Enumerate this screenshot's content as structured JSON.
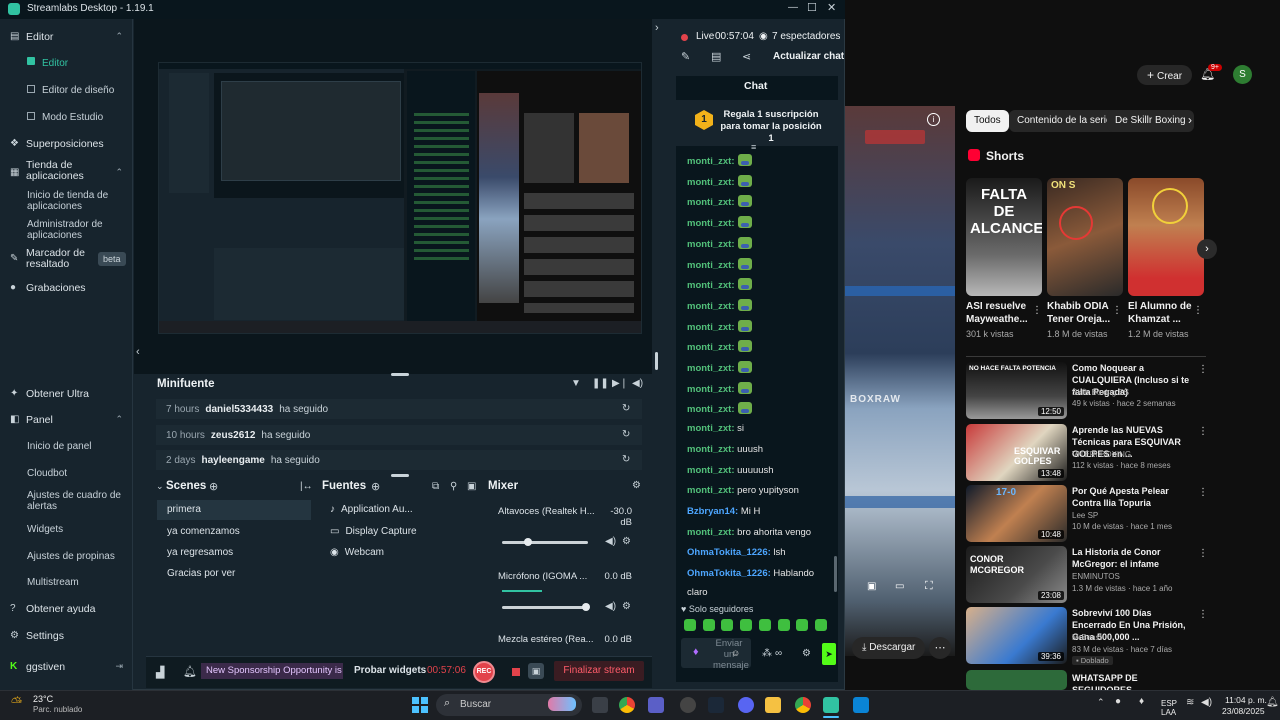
{
  "window": {
    "title": "Streamlabs Desktop - 1.19.1"
  },
  "sidebar": {
    "editor": "Editor",
    "editor_items": [
      "Editor",
      "Editor de diseño",
      "Modo Estudio"
    ],
    "overlays": "Superposiciones",
    "app_store": "Tienda de aplicaciones",
    "app_store_items": [
      "Inicio de tienda de aplicaciones",
      "Administrador de aplicaciones"
    ],
    "highlighter": "Marcador de resaltado",
    "beta": "beta",
    "recordings": "Grabaciones",
    "ultra": "Obtener Ultra",
    "panel": "Panel",
    "panel_items": [
      "Inicio de panel",
      "Cloudbot",
      "Ajustes de cuadro de alertas",
      "Widgets",
      "Ajustes de propinas",
      "Multistream"
    ],
    "help": "Obtener ayuda",
    "settings": "Settings",
    "user": "ggstiven"
  },
  "minifeed": {
    "title": "Minifuente",
    "events": [
      {
        "time": "7 hours",
        "user": "daniel5334433",
        "action": "ha seguido"
      },
      {
        "time": "10 hours",
        "user": "zeus2612",
        "action": "ha seguido"
      },
      {
        "time": "2 days",
        "user": "hayleengame",
        "action": "ha seguido"
      }
    ]
  },
  "scenes": {
    "title": "Scenes",
    "items": [
      "primera",
      "ya comenzamos",
      "ya regresamos",
      "Gracias por ver"
    ]
  },
  "sources": {
    "title": "Fuentes",
    "items": [
      "Application Au...",
      "Display Capture",
      "Webcam"
    ]
  },
  "mixer": {
    "title": "Mixer",
    "channels": [
      {
        "name": "Altavoces (Realtek H...",
        "value": "-30.0 dB"
      },
      {
        "name": "Micrófono (IGOMA ...",
        "value": "0.0 dB"
      },
      {
        "name": "Mezcla estéreo (Rea...",
        "value": "0.0 dB"
      }
    ]
  },
  "footer": {
    "ticker": "New Sponsorship Opportunity is l",
    "test_widgets": "Probar widgets",
    "rec_time": "00:57:06",
    "rec": "REC",
    "end_stream": "Finalizar stream"
  },
  "chat": {
    "live_label": "Live",
    "live_time": "00:57:04",
    "viewers": "7 espectadores",
    "refresh": "Actualizar chat",
    "title": "Chat",
    "gift_number": "1",
    "gift_text": "Regala 1 suscripción para tomar la posición 1",
    "messages": [
      {
        "user": "monti_zxt:",
        "text": ""
      },
      {
        "user": "monti_zxt:",
        "text": ""
      },
      {
        "user": "monti_zxt:",
        "text": ""
      },
      {
        "user": "monti_zxt:",
        "text": ""
      },
      {
        "user": "monti_zxt:",
        "text": ""
      },
      {
        "user": "monti_zxt:",
        "text": ""
      },
      {
        "user": "monti_zxt:",
        "text": ""
      },
      {
        "user": "monti_zxt:",
        "text": ""
      },
      {
        "user": "monti_zxt:",
        "text": ""
      },
      {
        "user": "monti_zxt:",
        "text": ""
      },
      {
        "user": "monti_zxt:",
        "text": ""
      },
      {
        "user": "monti_zxt:",
        "text": ""
      },
      {
        "user": "monti_zxt:",
        "text": ""
      },
      {
        "user": "monti_zxt:",
        "text": " si"
      },
      {
        "user": "monti_zxt:",
        "text": " uuush"
      },
      {
        "user": "monti_zxt:",
        "text": " uuuuush"
      },
      {
        "user": "monti_zxt:",
        "text": " pero yupityson"
      },
      {
        "user": "Bzbryan14:",
        "text": " Mi H"
      },
      {
        "user": "monti_zxt:",
        "text": " bro ahorita vengo"
      },
      {
        "user": "OhmaTokita_1226:",
        "text": " lsh"
      },
      {
        "user": "OhmaTokita_1226:",
        "text": " Hablando"
      }
    ],
    "last_line": "claro",
    "followers_only": "Solo seguidores",
    "send_placeholder": "Enviar un mensaje"
  },
  "youtube": {
    "create": "Crear",
    "notif": "9+",
    "avatar": "S",
    "chips": [
      "Todos",
      "Contenido de la serie",
      "De Skillr Boxing"
    ],
    "shorts_title": "Shorts",
    "shorts": [
      {
        "title": "ASI resuelve Mayweathe...",
        "views": "301 k vistas",
        "thumb": "FALTA DE ALCANCE"
      },
      {
        "title": "Khabib ODIA Tener Oreja...",
        "views": "1.8 M de vistas",
        "thumb": "ON S"
      },
      {
        "title": "El Alumno de Khamzat ...",
        "views": "1.2 M de vistas",
        "thumb": ""
      }
    ],
    "videos": [
      {
        "title": "Como Noquear a CUALQUIERA (Incluso si te falta Pegada)",
        "channel": "Skillr Boxing ES",
        "meta": "49 k vistas · hace 2 semanas",
        "duration": "12:50",
        "thumb_text": "NO HACE FALTA POTENCIA"
      },
      {
        "title": "Aprende las NUEVAS Técnicas para ESQUIVAR GOLPES en ...",
        "channel": "VITERI BOXING",
        "meta": "112 k vistas · hace 8 meses",
        "duration": "13:48",
        "thumb_text": "ESQUIVAR GOLPES"
      },
      {
        "title": "Por Qué Apesta Pelear Contra Ilia Topuria",
        "channel": "Lee SP",
        "meta": "10 M de vistas · hace 1 mes",
        "duration": "10:48",
        "thumb_text": "17-0"
      },
      {
        "title": "La Historia de Conor McGregor: el infame",
        "channel": "ENMINUTOS",
        "meta": "1.3 M de vistas · hace 1 año",
        "duration": "23:08",
        "thumb_text": "CONOR MCGREGOR"
      },
      {
        "title": "Sobreviví 100 Días Encerrado En Una Prisión, Gana 500,000 ...",
        "channel": "MrBeast",
        "meta": "83 M de vistas · hace 7 días",
        "duration": "39:36",
        "thumb_text": ""
      },
      {
        "title": "WHATSAPP DE SEGUIDORES",
        "channel": "",
        "meta": "",
        "duration": "",
        "thumb_text": ""
      }
    ],
    "doblado": "Doblado",
    "download": "Descargar"
  },
  "taskbar": {
    "weather_temp": "23°C",
    "weather_desc": "Parc. nublado",
    "search": "Buscar",
    "lang": "ESP",
    "lang2": "LAA",
    "time": "11:04 p. m.",
    "date": "23/08/2025"
  },
  "colors": {
    "accent": "#31c3a2",
    "live_red": "#e2434b",
    "chat_user": "#52c07a"
  }
}
